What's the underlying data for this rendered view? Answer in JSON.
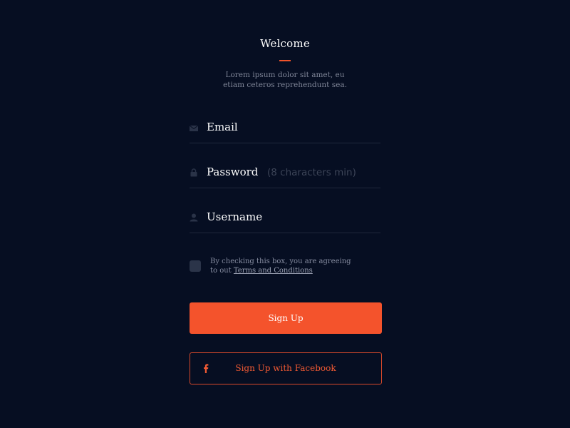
{
  "welcome": {
    "title": "Welcome",
    "subtitle_line1": "Lorem ipsum dolor sit amet, eu",
    "subtitle_line2": "etiam ceteros reprehendunt sea."
  },
  "form": {
    "email": {
      "label": "Email",
      "icon": "envelope-icon"
    },
    "password": {
      "label": "Password",
      "hint": "(8 characters min)",
      "icon": "lock-icon"
    },
    "username": {
      "label": "Username",
      "icon": "user-icon"
    }
  },
  "terms": {
    "line1": "By checking this box, you are agreeing",
    "line2_prefix": "to out ",
    "link_text": "Terms and Conditions"
  },
  "buttons": {
    "signup_label": "Sign Up",
    "facebook_label": "Sign Up with Facebook",
    "facebook_icon": "facebook-icon"
  },
  "colors": {
    "background": "#060e22",
    "accent": "#f4532c",
    "divider": "#1f283c",
    "muted_text": "#7f8597"
  }
}
